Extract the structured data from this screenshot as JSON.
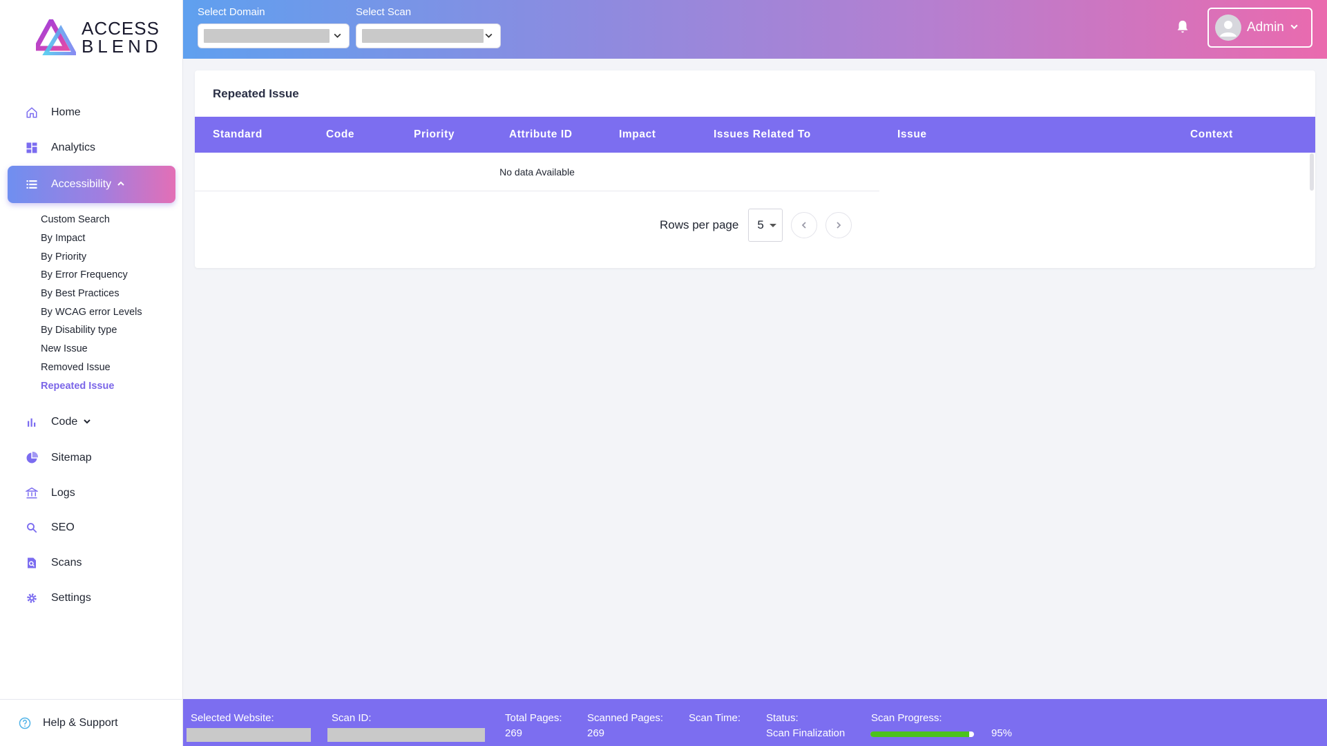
{
  "brand": {
    "line1": "ACCESS",
    "line2": "BLEND"
  },
  "header": {
    "domain_label": "Select Domain",
    "scan_label": "Select Scan",
    "user_label": "Admin"
  },
  "sidebar": {
    "items": [
      {
        "label": "Home",
        "icon": "home-icon"
      },
      {
        "label": "Analytics",
        "icon": "dashboard-icon"
      },
      {
        "label": "Accessibility",
        "icon": "list-icon"
      },
      {
        "label": "Code",
        "icon": "bar-chart-icon"
      },
      {
        "label": "Sitemap",
        "icon": "pie-chart-icon"
      },
      {
        "label": "Logs",
        "icon": "bank-icon"
      },
      {
        "label": "SEO",
        "icon": "search-icon"
      },
      {
        "label": "Scans",
        "icon": "document-search-icon"
      },
      {
        "label": "Settings",
        "icon": "gear-icon"
      }
    ],
    "subitems": [
      "Custom Search",
      "By Impact",
      "By Priority",
      "By Error Frequency",
      "By Best Practices",
      "By WCAG error Levels",
      "By Disability type",
      "New Issue",
      "Removed Issue",
      "Repeated Issue"
    ],
    "help": "Help & Support"
  },
  "main": {
    "title": "Repeated Issue",
    "columns": [
      "Standard",
      "Code",
      "Priority",
      "Attribute ID",
      "Impact",
      "Issues Related To",
      "Issue",
      "Context"
    ],
    "empty_message": "No data Available",
    "rows_per_page_label": "Rows per page",
    "rows_per_page_value": "5"
  },
  "footer": {
    "selected_website_label": "Selected Website:",
    "scan_id_label": "Scan ID:",
    "total_pages_label": "Total Pages:",
    "total_pages_value": "269",
    "scanned_pages_label": "Scanned Pages:",
    "scanned_pages_value": "269",
    "scan_time_label": "Scan Time:",
    "status_label": "Status:",
    "status_value": "Scan Finalization",
    "scan_progress_label": "Scan Progress:",
    "scan_progress_value": "95%",
    "scan_progress_fraction": 0.95
  },
  "colors": {
    "accent": "#7c6ef0",
    "active_sub": "#7b66e8",
    "progress": "#4cc21c"
  }
}
